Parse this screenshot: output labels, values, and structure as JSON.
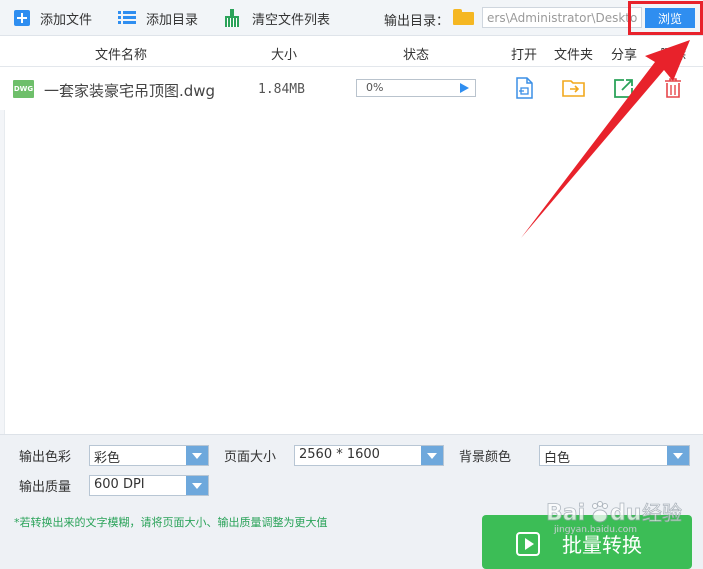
{
  "toolbar": {
    "add_file_label": "添加文件",
    "add_dir_label": "添加目录",
    "clear_list_label": "清空文件列表",
    "output_dir_label": "输出目录：",
    "output_dir_value": "ers\\Administrator\\Desktop",
    "browse_label": "浏览"
  },
  "table": {
    "headers": {
      "name": "文件名称",
      "size": "大小",
      "status": "状态",
      "open": "打开",
      "folder": "文件夹",
      "share": "分享",
      "delete": "删除"
    },
    "rows": [
      {
        "type_badge": "DWG",
        "name": "一套家装豪宅吊顶图.dwg",
        "size": "1.84MB",
        "progress_text": "0%",
        "progress_value": 0,
        "actions": [
          "open-file-icon",
          "open-folder-icon",
          "share-icon",
          "trash-icon"
        ]
      }
    ]
  },
  "options": {
    "color_label": "输出色彩",
    "color_value": "彩色",
    "page_size_label": "页面大小",
    "page_size_value": "2560 * 1600",
    "bg_color_label": "背景颜色",
    "bg_color_value": "白色",
    "quality_label": "输出质量",
    "quality_value": "600 DPI"
  },
  "footer": {
    "hint": "*若转换出来的文字模糊，请将页面大小、输出质量调整为更大值",
    "convert_label": "批量转换"
  },
  "watermark": {
    "text": "Baidu 经验",
    "subtext": "jingyan.baidu.com"
  },
  "colors": {
    "accent_blue": "#2f8ef0",
    "convert_green": "#3cbd56",
    "annotation_red": "#e8222b",
    "hint_green": "#2ba35a"
  }
}
